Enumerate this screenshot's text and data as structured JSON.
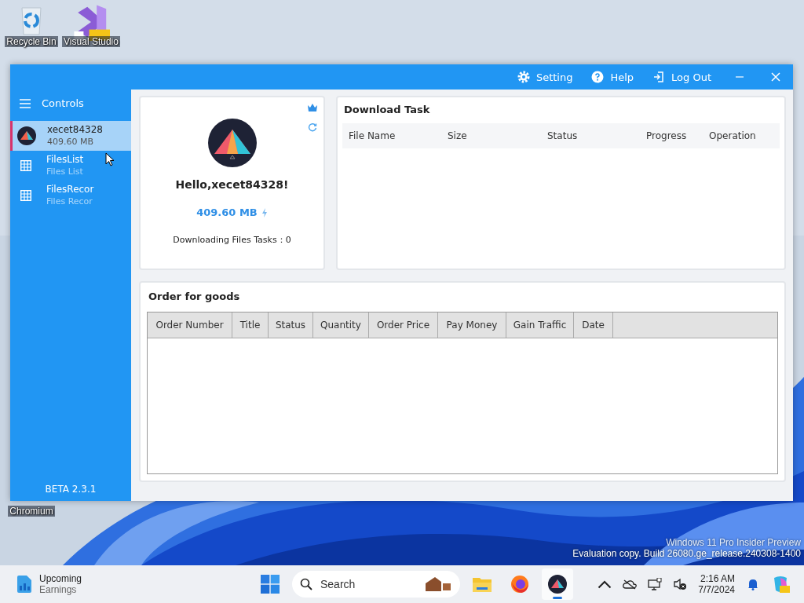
{
  "desktop": {
    "icons": [
      {
        "kind": "recycle",
        "label": "Recycle Bin"
      },
      {
        "kind": "studio",
        "label": "Visual Studio"
      },
      {
        "kind": "chromium",
        "label": "Chromium"
      }
    ],
    "watermark": [
      "Windows 11 Pro Insider Preview",
      "Evaluation copy. Build 26080.ge_release.240308-1400"
    ]
  },
  "window": {
    "toolbar": [
      {
        "kind": "setting",
        "label": "Setting"
      },
      {
        "kind": "help",
        "label": "Help"
      },
      {
        "kind": "logout",
        "label": "Log Out"
      }
    ],
    "sidebar": {
      "title": "Controls",
      "items": [
        {
          "kind": "avatar",
          "name": "xecet84328",
          "sub": "409.60 MB",
          "selected": true
        },
        {
          "kind": "table",
          "name": "FilesList",
          "sub": "Files List",
          "selected": false
        },
        {
          "kind": "table",
          "name": "FilesRecor",
          "sub": "Files Recor",
          "selected": false
        }
      ],
      "version": "BETA 2.3.1"
    },
    "profile": {
      "greeting": "Hello,xecet84328!",
      "storage": "409.60 MB",
      "tasks": "Downloading Files Tasks：0"
    },
    "download_task": {
      "title": "Download Task",
      "columns": [
        "File Name",
        "Size",
        "Status",
        "Progress",
        "Operation"
      ]
    },
    "orders": {
      "title": "Order for goods",
      "columns": [
        "Order Number",
        "Title",
        "Status",
        "Quantity",
        "Order Price",
        "Pay Money",
        "Gain Traffic",
        "Date"
      ]
    }
  },
  "taskbar": {
    "widget": {
      "title": "Upcoming",
      "subtitle": "Earnings"
    },
    "search": {
      "placeholder": "Search"
    },
    "apps": [
      {
        "kind": "folder",
        "active": false
      },
      {
        "kind": "firefox",
        "active": false
      },
      {
        "kind": "app",
        "active": true
      }
    ],
    "time": "2:16 AM",
    "date": "7/7/2024"
  }
}
